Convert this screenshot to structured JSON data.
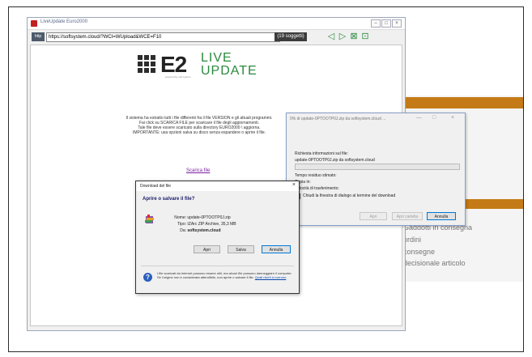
{
  "main_window": {
    "title": "LiveUpdate Euro2000",
    "controls": [
      "–",
      "□",
      "×"
    ],
    "http_badge": "http",
    "url": "https://softsystem.cloud/?WCI=WUpload&WCE=F10",
    "count_badge": "(19 soggetti)",
    "nav_icons": [
      "back-icon",
      "forward-icon",
      "stop-icon",
      "refresh-icon"
    ]
  },
  "logo": {
    "brand": "E2",
    "line1": "LIVE",
    "line2": "UPDATE",
    "tagline": "powered by soft system"
  },
  "info_lines": [
    "Il sistema ha estratto tutti i file differenti fra il file VERSION e gli attuali programmi.",
    "Fai click su SCARICA FILE per scaricare il file degli aggiornamenti.",
    "Tale file deve essere scaricato sulla directory EURO2000 \\ aggiorna.",
    "IMPORTANTE: usa opzioni salva su disco senza espandere o aprire il file."
  ],
  "scarica_link": "Scarica file",
  "progress_dialog": {
    "title": "0% di update-0PTOOTP0J.zip da softsystem.cloud ...",
    "controls": [
      "—",
      "□",
      "×"
    ],
    "info_label": "Richiesta informazioni sul file:",
    "file_line": "update-0PTOOTP0J.zip da softsystem.cloud",
    "progress_fraction": 0.0,
    "time_label": "Tempo residuo stimato:",
    "copy_label": "Copia in:",
    "rate_label": "Velocità di trasferimento:",
    "close_checkbox_label": "Chiudi la finestra di dialogo al termine del download",
    "buttons": {
      "open": "Apri",
      "open_folder": "Apri cartella",
      "cancel": "Annulla"
    }
  },
  "download_dialog": {
    "title": "Download del file",
    "close": "×",
    "heading": "Aprire o salvare il file?",
    "name_key": "Nome:",
    "name_value": "update-0PTOOTP0J.zip",
    "type_key": "Tipo:",
    "type_value": "IZArc ZIP Archive, 35,3 MB",
    "from_key": "Da:",
    "from_value": "softsystem.cloud",
    "buttons": {
      "open": "Apri",
      "save": "Salva",
      "cancel": "Annulla"
    },
    "warning": "I file scaricati da Internet possono essere utili, ma alcuni file possono danneggiare il computer. Se l'origine non è considerata attendibile, non aprire o salvare il file.",
    "warning_link": "Quali rischi si corrono"
  },
  "background_app": {
    "lines": [
      "Gaddotti in consegna",
      "ordini",
      "consegne",
      "decisionale articolo"
    ]
  }
}
